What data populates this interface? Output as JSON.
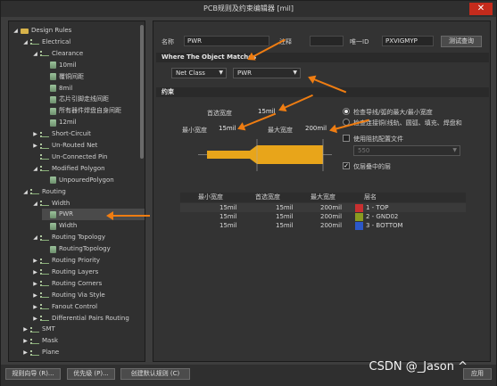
{
  "window": {
    "title": "PCB规则及约束编辑器 [mil]"
  },
  "tree": {
    "items": [
      {
        "label": "Design Rules",
        "level": 0,
        "arrow": "open",
        "icon": "folder"
      },
      {
        "label": "Electrical",
        "level": 1,
        "arrow": "open",
        "icon": "rule-group"
      },
      {
        "label": "Clearance",
        "level": 2,
        "arrow": "open",
        "icon": "rule-group"
      },
      {
        "label": "10mil",
        "level": 3,
        "arrow": "",
        "icon": "rule"
      },
      {
        "label": "覆铜间距",
        "level": 3,
        "arrow": "",
        "icon": "rule"
      },
      {
        "label": "8mil",
        "level": 3,
        "arrow": "",
        "icon": "rule"
      },
      {
        "label": "芯片引脚走线间距",
        "level": 3,
        "arrow": "",
        "icon": "rule"
      },
      {
        "label": "所有器件焊盘自身间距",
        "level": 3,
        "arrow": "",
        "icon": "rule"
      },
      {
        "label": "12mil",
        "level": 3,
        "arrow": "",
        "icon": "rule"
      },
      {
        "label": "Short-Circuit",
        "level": 2,
        "arrow": "closed",
        "icon": "rule-group"
      },
      {
        "label": "Un-Routed Net",
        "level": 2,
        "arrow": "closed",
        "icon": "rule-group"
      },
      {
        "label": "Un-Connected Pin",
        "level": 2,
        "arrow": "",
        "icon": "rule-group"
      },
      {
        "label": "Modified Polygon",
        "level": 2,
        "arrow": "open",
        "icon": "rule-group"
      },
      {
        "label": "UnpouredPolygon",
        "level": 3,
        "arrow": "",
        "icon": "rule"
      },
      {
        "label": "Routing",
        "level": 1,
        "arrow": "open",
        "icon": "rule-group"
      },
      {
        "label": "Width",
        "level": 2,
        "arrow": "open",
        "icon": "rule-group"
      },
      {
        "label": "PWR",
        "level": 3,
        "arrow": "",
        "icon": "rule",
        "selected": true
      },
      {
        "label": "Width",
        "level": 3,
        "arrow": "",
        "icon": "rule"
      },
      {
        "label": "Routing Topology",
        "level": 2,
        "arrow": "open",
        "icon": "rule-group"
      },
      {
        "label": "RoutingTopology",
        "level": 3,
        "arrow": "",
        "icon": "rule"
      },
      {
        "label": "Routing Priority",
        "level": 2,
        "arrow": "closed",
        "icon": "rule-group"
      },
      {
        "label": "Routing Layers",
        "level": 2,
        "arrow": "closed",
        "icon": "rule-group"
      },
      {
        "label": "Routing Corners",
        "level": 2,
        "arrow": "closed",
        "icon": "rule-group"
      },
      {
        "label": "Routing Via Style",
        "level": 2,
        "arrow": "closed",
        "icon": "rule-group"
      },
      {
        "label": "Fanout Control",
        "level": 2,
        "arrow": "closed",
        "icon": "rule-group"
      },
      {
        "label": "Differential Pairs Routing",
        "level": 2,
        "arrow": "closed",
        "icon": "rule-group"
      },
      {
        "label": "SMT",
        "level": 1,
        "arrow": "closed",
        "icon": "rule-group"
      },
      {
        "label": "Mask",
        "level": 1,
        "arrow": "closed",
        "icon": "rule-group"
      },
      {
        "label": "Plane",
        "level": 1,
        "arrow": "closed",
        "icon": "rule-group"
      }
    ]
  },
  "rule": {
    "name_label": "名称",
    "name_value": "PWR",
    "comment_label": "注释",
    "comment_value": "",
    "uid_label": "唯一ID",
    "uid_value": "PXVIGMYP",
    "test_button": "测试查询"
  },
  "match": {
    "heading": "Where The Object Matches",
    "type_value": "Net Class",
    "class_value": "PWR"
  },
  "constraints": {
    "heading": "约束",
    "preferred_label": "首选宽度",
    "preferred_value": "15mil",
    "min_label": "最小宽度",
    "min_value": "15mil",
    "max_label": "最大宽度",
    "max_value": "200mil",
    "radio1": "检查导线/弧的最大/最小宽度",
    "radio2": "检查连接铜(线轨、圆弧、填充、焊盘和",
    "use_impedance": "使用阻抗配置文件",
    "impedance_value": "550",
    "layer_stack_only": "仅层叠中的层"
  },
  "table": {
    "headers": [
      "最小宽度",
      "首选宽度",
      "最大宽度",
      "层名"
    ],
    "rows": [
      {
        "min": "15mil",
        "pref": "15mil",
        "max": "200mil",
        "layer": "1 - TOP",
        "color": "#c83030"
      },
      {
        "min": "15mil",
        "pref": "15mil",
        "max": "200mil",
        "layer": "2 - GND02",
        "color": "#8a9a20"
      },
      {
        "min": "15mil",
        "pref": "15mil",
        "max": "200mil",
        "layer": "3 - BOTTOM",
        "color": "#2c58c8"
      }
    ]
  },
  "footer": {
    "wizard_button": "规则向导 (R)...",
    "priority_button": "优先级 (P)...",
    "create_default_button": "创建默认规则 (C)",
    "apply_button": "应用",
    "watermark": "CSDN @_Jason ^"
  },
  "colors": {
    "accent_arrow": "#ef7d12",
    "trace": "#e8a51a"
  }
}
